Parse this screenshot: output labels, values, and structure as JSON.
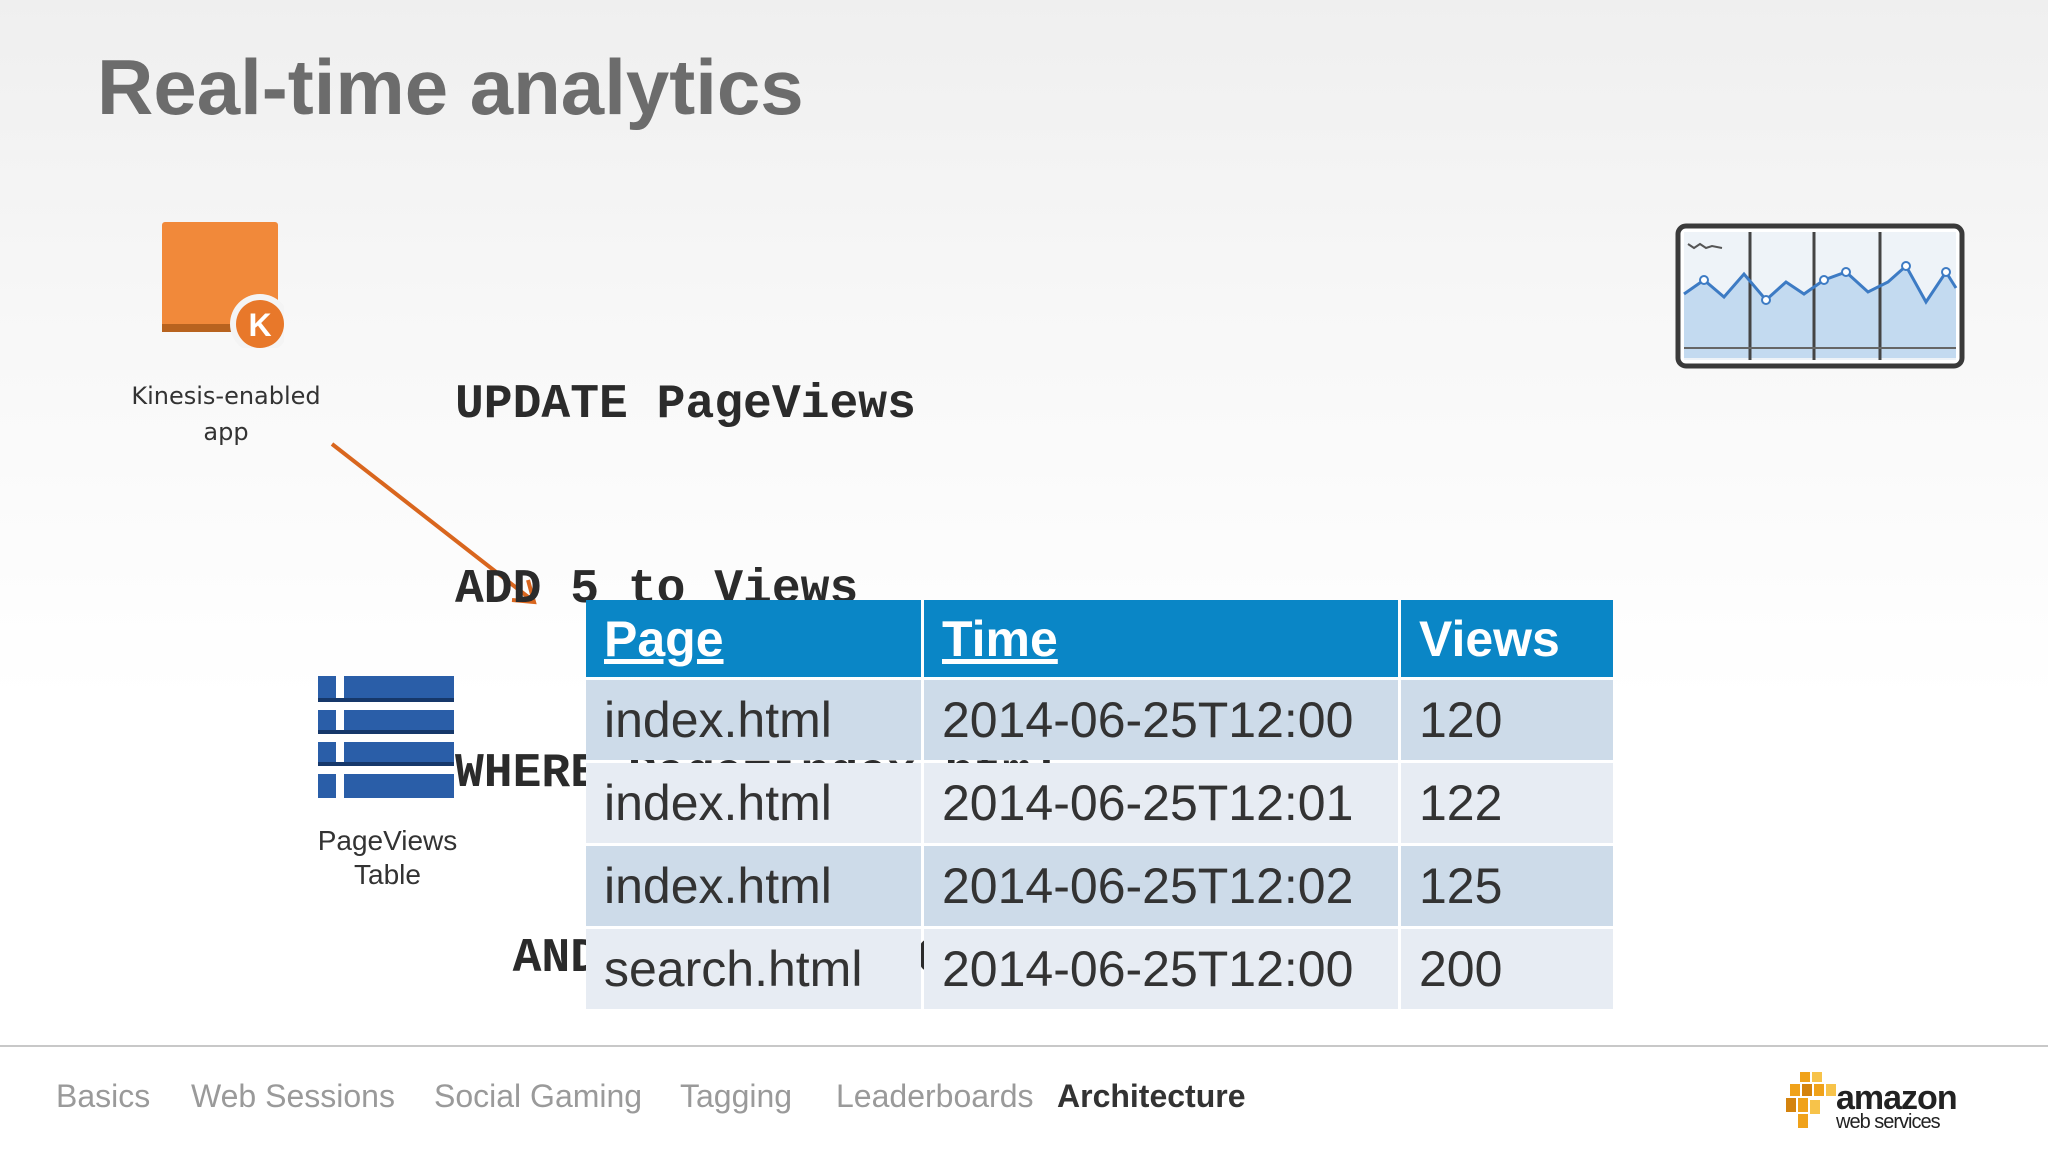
{
  "slide": {
    "title": "Real-time analytics"
  },
  "kinesis": {
    "label_line1": "Kinesis-enabled",
    "label_line2": "app",
    "icon_letter": "K",
    "color": "#f1893a"
  },
  "code": {
    "lines": [
      "UPDATE PageViews",
      "ADD 5 to Views",
      "WHERE Page=index.html",
      "  AND Time=2014-06-25T12:00"
    ]
  },
  "table_icon": {
    "label_line1": "PageViews",
    "label_line2": "Table",
    "color": "#2a5ea8"
  },
  "table": {
    "headers": [
      "Page",
      "Time",
      "Views"
    ],
    "rows": [
      [
        "index.html",
        "2014-06-25T12:00",
        "120"
      ],
      [
        "index.html",
        "2014-06-25T12:01",
        "122"
      ],
      [
        "index.html",
        "2014-06-25T12:02",
        "125"
      ],
      [
        "search.html",
        "2014-06-25T12:00",
        "200"
      ]
    ],
    "header_color": "#0a86c6"
  },
  "nav": {
    "items": [
      "Basics",
      "Web Sessions",
      "Social Gaming",
      "Tagging",
      "Leaderboards",
      "Architecture"
    ],
    "active": "Architecture"
  },
  "brand": {
    "word": "amazon",
    "sub": "web services",
    "accent": "#f0a21a"
  },
  "icons": {
    "kinesis": "kinesis-icon",
    "arrow": "arrow-icon",
    "dashboard": "dashboard-chart-icon",
    "table": "table-icon",
    "logo": "aws-logo-icon"
  }
}
